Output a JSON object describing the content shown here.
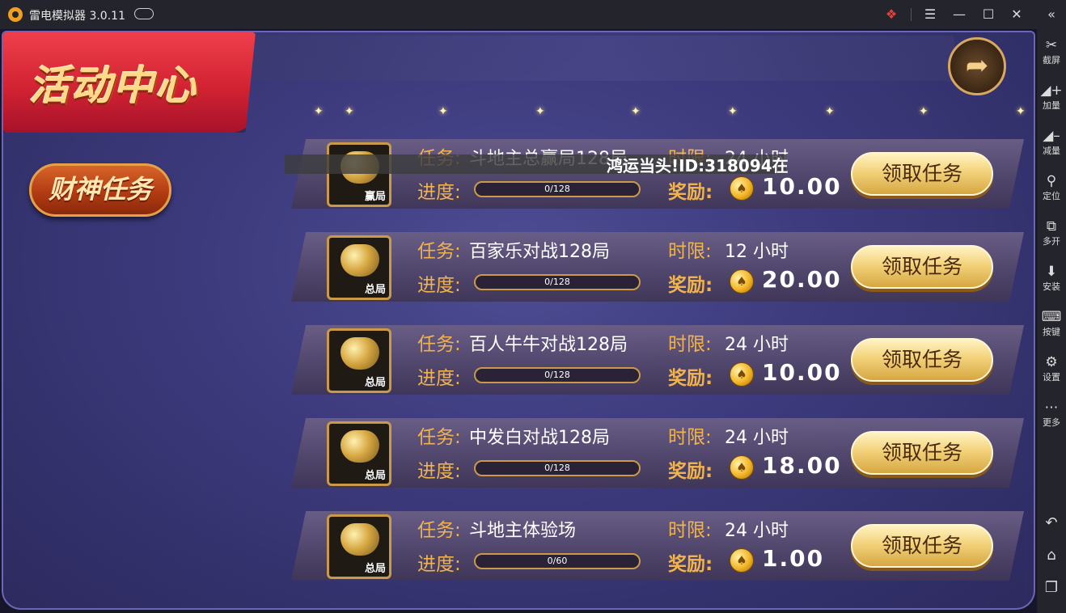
{
  "window": {
    "title": "雷电模拟器 3.0.11",
    "icons": [
      "app-logo-icon",
      "gamepad-icon",
      "gift-icon",
      "menu-icon",
      "minimize-icon",
      "maximize-icon",
      "close-icon",
      "collapse-icon"
    ]
  },
  "sidebar": {
    "items": [
      {
        "label": "截屏",
        "icon": "scissors-icon"
      },
      {
        "label": "加量",
        "icon": "volume-up-icon"
      },
      {
        "label": "减量",
        "icon": "volume-down-icon"
      },
      {
        "label": "定位",
        "icon": "location-icon"
      },
      {
        "label": "多开",
        "icon": "multi-instance-icon"
      },
      {
        "label": "安装",
        "icon": "apk-install-icon"
      },
      {
        "label": "按键",
        "icon": "keyboard-icon"
      },
      {
        "label": "设置",
        "icon": "settings-icon"
      },
      {
        "label": "更多",
        "icon": "more-icon"
      }
    ],
    "nav": [
      "back-icon",
      "home-icon",
      "recent-apps-icon"
    ]
  },
  "game": {
    "title": "活动中心",
    "category_button": "财神任务",
    "overlay_text": "鸿运当头!ID:318094在",
    "labels": {
      "task": "任务:",
      "progress": "进度:",
      "time_limit": "时限:",
      "reward": "奖励:",
      "claim": "领取任务"
    },
    "tasks": [
      {
        "name": "斗地主总赢局128局",
        "time": "24 小时",
        "progress": "0/128",
        "progress_fraction": 0,
        "reward": "10.00",
        "badge": "赢局"
      },
      {
        "name": "百家乐对战128局",
        "time": "12 小时",
        "progress": "0/128",
        "progress_fraction": 0,
        "reward": "20.00",
        "badge": "总局"
      },
      {
        "name": "百人牛牛对战128局",
        "time": "24 小时",
        "progress": "0/128",
        "progress_fraction": 0,
        "reward": "10.00",
        "badge": "总局"
      },
      {
        "name": "中发白对战128局",
        "time": "24 小时",
        "progress": "0/128",
        "progress_fraction": 0,
        "reward": "18.00",
        "badge": "总局"
      },
      {
        "name": "斗地主体验场",
        "time": "24 小时",
        "progress": "0/60",
        "progress_fraction": 0,
        "reward": "1.00",
        "badge": "总局"
      }
    ]
  }
}
